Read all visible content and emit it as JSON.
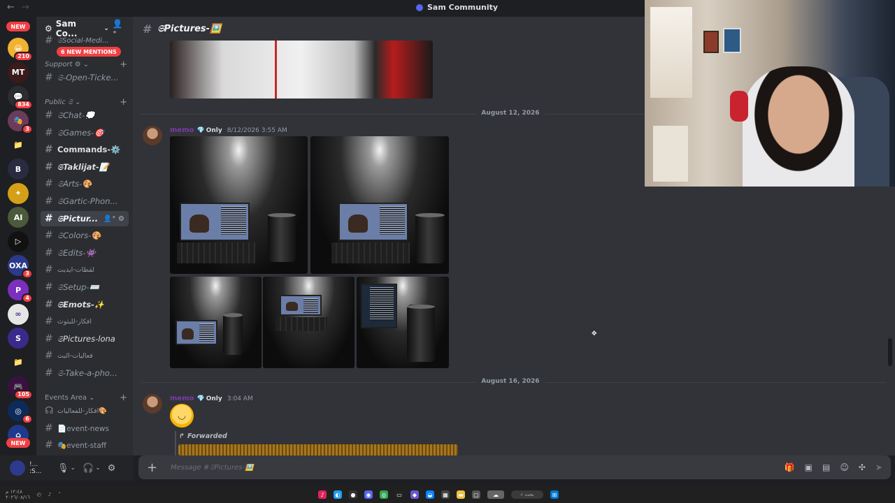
{
  "window": {
    "title": "Sam Community",
    "nav_back": "←",
    "nav_forward": "→"
  },
  "rail": {
    "new_top": "NEW",
    "new_bottom": "NEW",
    "servers": [
      {
        "label": "😀",
        "color": "#f0b232",
        "badge": "210"
      },
      {
        "label": "MT",
        "color": "#3a1a1a",
        "badge": ""
      },
      {
        "label": "💬",
        "color": "#2b2d31",
        "badge": "834"
      },
      {
        "label": "🎭",
        "color": "#6a3b5a",
        "badge": "3"
      },
      {
        "label": "📁",
        "color": "#1e1f22",
        "badge": ""
      },
      {
        "label": "B",
        "color": "#2a2b40",
        "badge": ""
      },
      {
        "label": "✦",
        "color": "#d4a017",
        "badge": ""
      },
      {
        "label": "AI",
        "color": "#4a5a3a",
        "badge": ""
      },
      {
        "label": "▷",
        "color": "#111111",
        "badge": ""
      },
      {
        "label": "OXA",
        "color": "#2b3a8c",
        "badge": "3"
      },
      {
        "label": "P",
        "color": "#7b2fbf",
        "badge": "4"
      },
      {
        "label": "∞",
        "color": "#e6e6e6",
        "badge": ""
      },
      {
        "label": "S",
        "color": "#3b2a8c",
        "badge": ""
      },
      {
        "label": "📁",
        "color": "#1e1f22",
        "badge": ""
      },
      {
        "label": "🎮",
        "color": "#3a1040",
        "badge": "105"
      },
      {
        "label": "◎",
        "color": "#0d2b5a",
        "badge": "6"
      },
      {
        "label": "⌂",
        "color": "#1e3a8c",
        "badge": ""
      }
    ]
  },
  "guild": {
    "name": "Sam Co...",
    "mentions": "6 NEW MENTIONS",
    "social_media": "𝔖Social-Medi..."
  },
  "categories": {
    "support": "Support ⚙",
    "public": "Public 𝔖",
    "events": "Events Area"
  },
  "channels": {
    "open_ticket": "𝔖-Open-Ticke...",
    "chat": "𝔖Chat-💭",
    "games": "𝔖Games-🎯",
    "commands": "Commands-⚙️",
    "taklijat": "𝔖Taklijat-📝",
    "arts": "𝔖Arts-🎨",
    "gartic": "𝔖Gartic-Phon...",
    "pictures": "𝔖Pictur...",
    "colors": "𝔖Colors-🎨",
    "edits": "𝔖Edits-👾",
    "lqtat": "لقطات-ايديت",
    "setup": "𝔖Setup-⌨️",
    "emots": "𝔖Emots-✨",
    "afkar": "افكار-للبثوث",
    "pictures_lona": "𝔖Pictures-lona",
    "faaliyat": "فعاليات-البث",
    "take_photo": "𝔖-Take-a-pho...",
    "events_ideas": "افكار-للفعاليات🎨",
    "event_news": "📄event-news",
    "event_staff": "🎭event-staff"
  },
  "user": {
    "name": "!... :S..."
  },
  "chat": {
    "channel": "𝔖Pictures-🖼️",
    "date1": "August 12, 2026",
    "date2": "August 16, 2026",
    "msg1": {
      "author": "memo",
      "role": "Only",
      "time": "8/12/2026 3:55 AM"
    },
    "msg2": {
      "author": "memo",
      "role": "Only",
      "time": "3:04 AM",
      "forwarded": "Forwarded"
    }
  },
  "composer": {
    "placeholder": "Message #𝔖Pictures-🖼️"
  },
  "taskbar": {
    "clock": "١٢:٤٨ م",
    "date": "٢٠٢٦/٠٨/١٦",
    "search": "بحث"
  }
}
